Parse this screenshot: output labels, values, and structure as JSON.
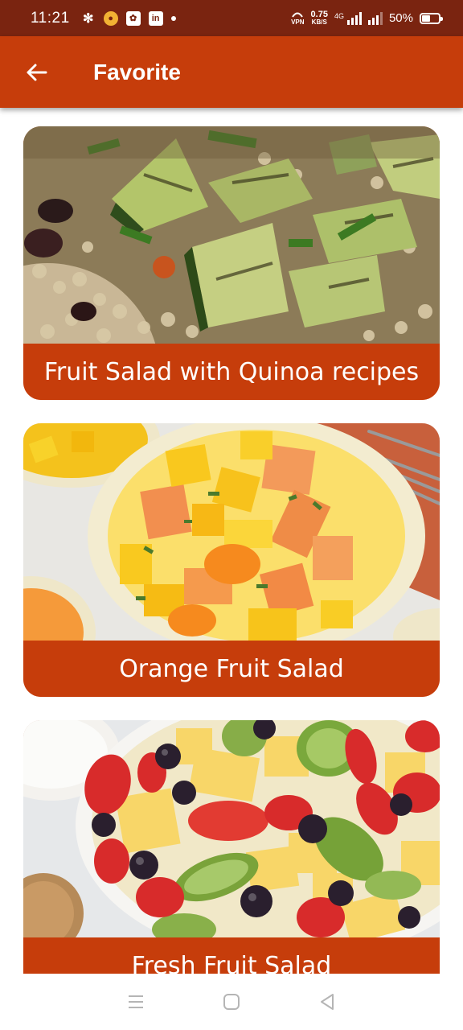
{
  "status_bar": {
    "time": "11:21",
    "vpn_label": "VPN",
    "speed_value": "0.75",
    "speed_unit": "KB/S",
    "network_label": "4G",
    "battery_percent": "50%",
    "battery_level": 0.5,
    "left_icons": [
      "bee-icon",
      "coin-icon",
      "flower-app-icon",
      "linkedin-icon",
      "notification-dot-icon"
    ]
  },
  "app_bar": {
    "title": "Favorite",
    "back_icon": "arrow-left-icon",
    "background": "#c63d0b"
  },
  "favorites": [
    {
      "title": "Fruit Salad with Quinoa recipes",
      "image": "quinoa-zucchini-salad-photo"
    },
    {
      "title": "Orange Fruit Salad",
      "image": "orange-fruit-salad-photo"
    },
    {
      "title": "Fresh Fruit Salad",
      "image": "fresh-fruit-salad-photo"
    }
  ],
  "nav_bar": {
    "icons": [
      "recent-apps-icon",
      "home-icon",
      "back-triangle-icon"
    ]
  },
  "colors": {
    "status_bar": "#7a2410",
    "accent": "#c63d0b",
    "caption_text": "#ffffff"
  }
}
